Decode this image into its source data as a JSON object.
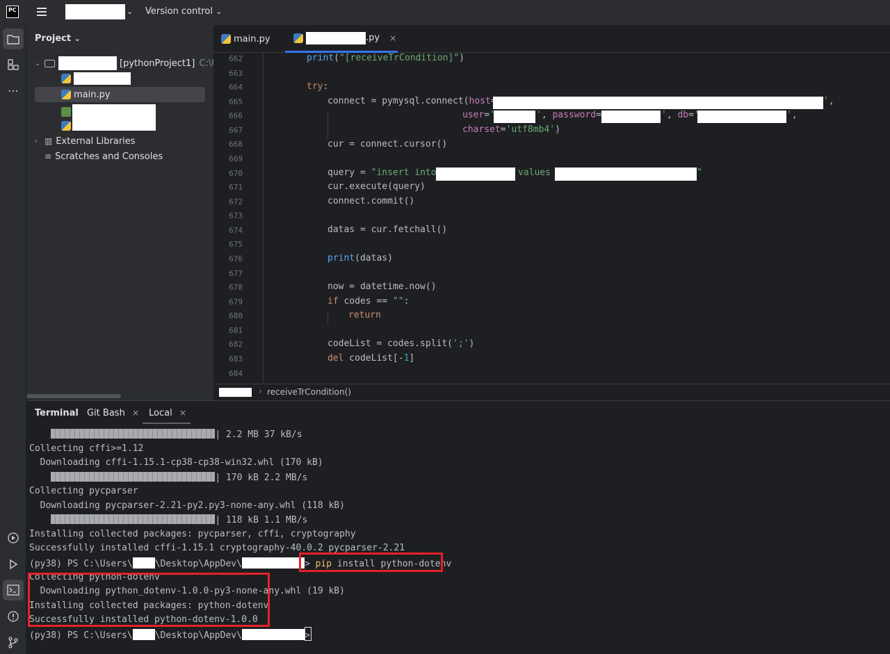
{
  "titlebar": {
    "logo": "PC",
    "vcs_label": "Version control"
  },
  "project_pane": {
    "title": "Project",
    "root_suffix": "[pythonProject1]",
    "root_path": "C:\\Us",
    "main_file": "main.py",
    "external_libraries": "External Libraries",
    "scratches": "Scratches and Consoles"
  },
  "editor": {
    "tabs": [
      {
        "label": "main.py"
      },
      {
        "label": ".py"
      }
    ],
    "lines": [
      {
        "n": "662"
      },
      {
        "n": "663"
      },
      {
        "n": "664"
      },
      {
        "n": "665"
      },
      {
        "n": "666"
      },
      {
        "n": "667"
      },
      {
        "n": "668"
      },
      {
        "n": "669"
      },
      {
        "n": "670"
      },
      {
        "n": "671"
      },
      {
        "n": "672"
      },
      {
        "n": "673"
      },
      {
        "n": "674"
      },
      {
        "n": "675"
      },
      {
        "n": "676"
      },
      {
        "n": "677"
      },
      {
        "n": "678"
      },
      {
        "n": "679"
      },
      {
        "n": "680"
      },
      {
        "n": "681"
      },
      {
        "n": "682"
      },
      {
        "n": "683"
      },
      {
        "n": "684"
      }
    ],
    "breadcrumb": "receiveTrCondition()"
  },
  "terminal": {
    "tabs": [
      "Terminal",
      "Git Bash",
      "Local"
    ],
    "lines": {
      "l1_rate": "| 2.2 MB 37 kB/s",
      "l2": "Collecting cffi>=1.12",
      "l3": "  Downloading cffi-1.15.1-cp38-cp38-win32.whl (170 kB)",
      "l4_rate": "| 170 kB 2.2 MB/s",
      "l5": "Collecting pycparser",
      "l6": "  Downloading pycparser-2.21-py2.py3-none-any.whl (118 kB)",
      "l7_rate": "| 118 kB 1.1 MB/s",
      "l8": "Installing collected packages: pycparser, cffi, cryptography",
      "l9": "Successfully installed cffi-1.15.1 cryptography-40.0.2 pycparser-2.21",
      "prompt_a": "(py38) PS C:\\Users\\",
      "prompt_b": "\\Desktop\\AppDev\\",
      "cmd_pip": "pip",
      "cmd_rest": " install python-dotenv",
      "l11": "Collecting python-dotenv",
      "l12": "  Downloading python_dotenv-1.0.0-py3-none-any.whl (19 kB)",
      "l13": "Installing collected packages: python-dotenv",
      "l14": "Successfully installed python-dotenv-1.0.0"
    }
  }
}
